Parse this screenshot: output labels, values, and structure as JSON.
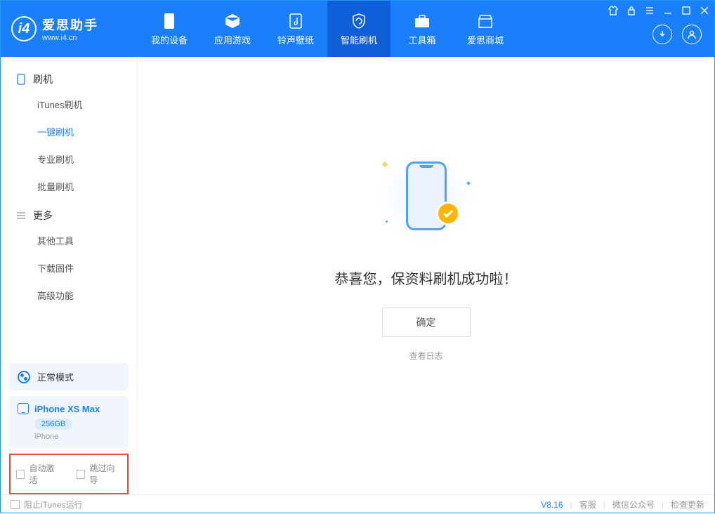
{
  "app": {
    "title": "爱思助手",
    "subtitle": "www.i4.cn"
  },
  "nav": {
    "tabs": [
      {
        "label": "我的设备"
      },
      {
        "label": "应用游戏"
      },
      {
        "label": "铃声壁纸"
      },
      {
        "label": "智能刷机"
      },
      {
        "label": "工具箱"
      },
      {
        "label": "爱思商城"
      }
    ]
  },
  "sidebar": {
    "group1": {
      "title": "刷机",
      "items": [
        "iTunes刷机",
        "一键刷机",
        "专业刷机",
        "批量刷机"
      ]
    },
    "group2": {
      "title": "更多",
      "items": [
        "其他工具",
        "下载固件",
        "高级功能"
      ]
    },
    "mode_label": "正常模式",
    "device": {
      "name": "iPhone XS Max",
      "storage": "256GB",
      "type": "iPhone"
    },
    "auto_activate": "自动激活",
    "skip_guide": "跳过向导"
  },
  "content": {
    "success_message": "恭喜您，保资料刷机成功啦！",
    "confirm_button": "确定",
    "view_log": "查看日志"
  },
  "footer": {
    "stop_itunes": "阻止iTunes运行",
    "version": "V8.16",
    "support": "客服",
    "wechat": "微信公众号",
    "check_update": "检查更新"
  }
}
